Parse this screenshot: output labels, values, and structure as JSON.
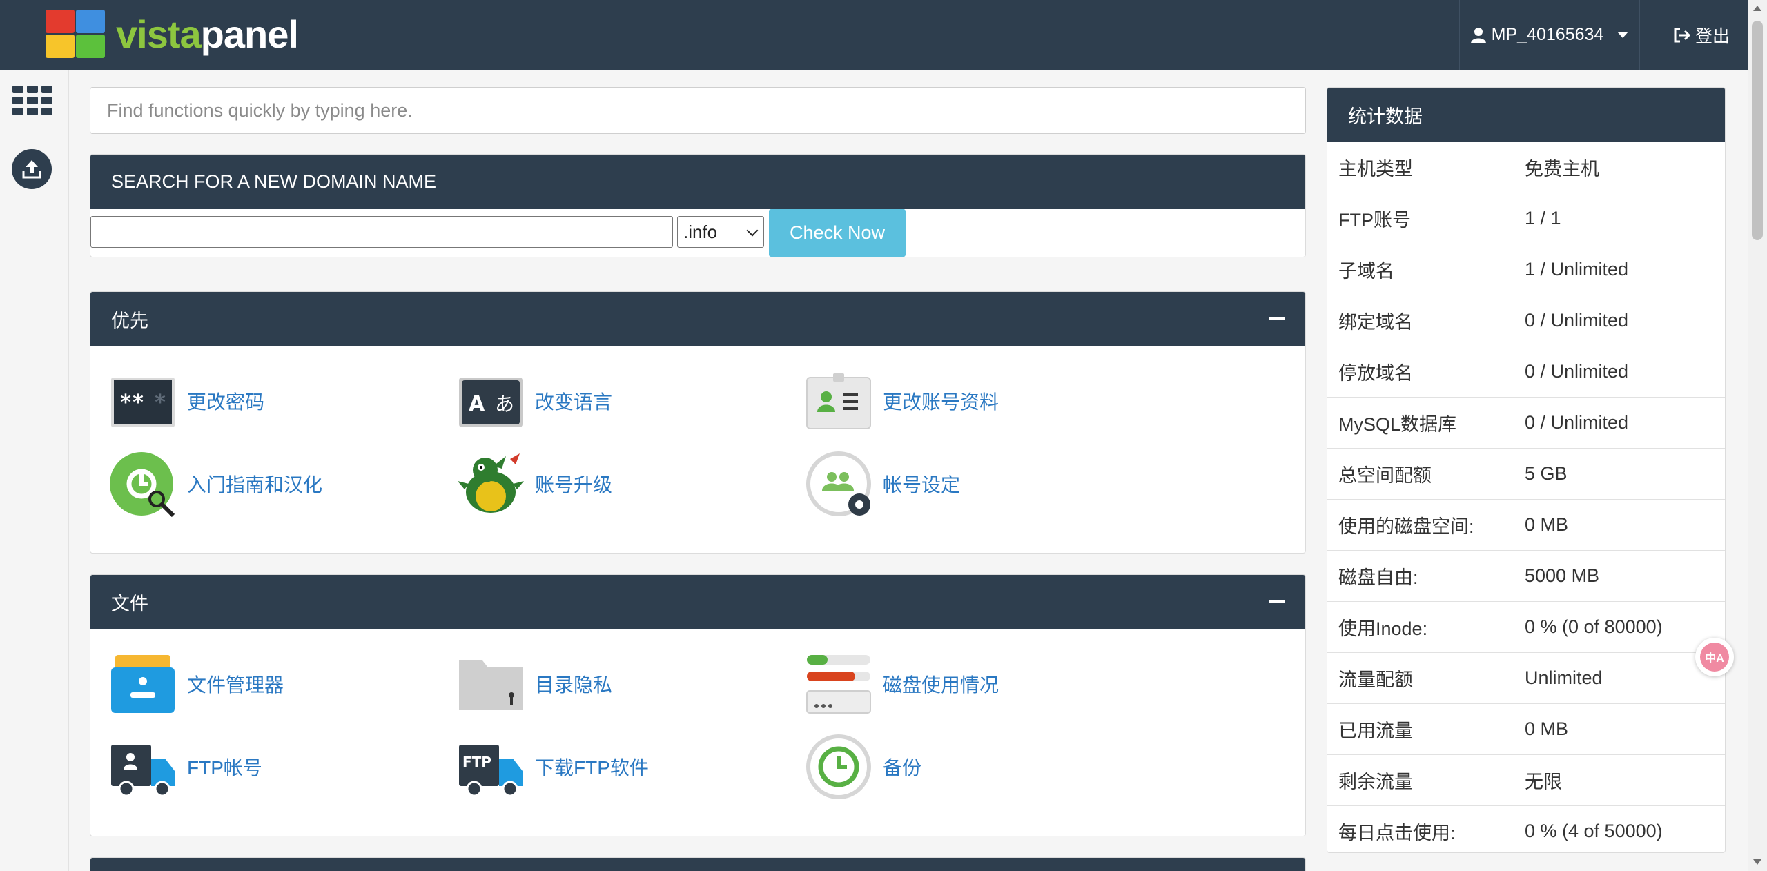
{
  "colors": {
    "navy": "#2e3e4e",
    "link": "#2a78c2",
    "check_btn": "#5bc0de",
    "logo_green": "#8dc63f"
  },
  "header": {
    "logo_part1": "vista",
    "logo_part2": "panel",
    "username": "MP_40165634",
    "logout_label": "登出"
  },
  "sidebar": {
    "icons": [
      "apps-grid-icon",
      "upload-icon"
    ]
  },
  "search": {
    "placeholder": "Find functions quickly by typing here."
  },
  "domain_search": {
    "title": "SEARCH FOR A NEW DOMAIN NAME",
    "input_value": "",
    "tld": ".info",
    "button": "Check Now"
  },
  "sections": {
    "priority": {
      "title": "优先",
      "items": [
        {
          "label": "更改密码",
          "icon": "password-icon"
        },
        {
          "label": "改变语言",
          "icon": "language-icon"
        },
        {
          "label": "更改账号资料",
          "icon": "account-card-icon"
        },
        {
          "label": "入门指南和汉化",
          "icon": "getting-started-icon"
        },
        {
          "label": "账号升级",
          "icon": "dragon-icon"
        },
        {
          "label": "帐号设定",
          "icon": "account-settings-icon"
        }
      ]
    },
    "files": {
      "title": "文件",
      "items": [
        {
          "label": "文件管理器",
          "icon": "file-manager-icon"
        },
        {
          "label": "目录隐私",
          "icon": "folder-lock-icon"
        },
        {
          "label": "磁盘使用情况",
          "icon": "disk-usage-icon"
        },
        {
          "label": "FTP帐号",
          "icon": "ftp-user-truck-icon"
        },
        {
          "label": "下载FTP软件",
          "icon": "ftp-truck-icon"
        },
        {
          "label": "备份",
          "icon": "backup-icon"
        }
      ]
    }
  },
  "stats": {
    "title": "统计数据",
    "rows": [
      {
        "k": "主机类型",
        "v": "免费主机"
      },
      {
        "k": "FTP账号",
        "v": "1 / 1"
      },
      {
        "k": "子域名",
        "v": "1 / Unlimited"
      },
      {
        "k": "绑定域名",
        "v": "0 / Unlimited"
      },
      {
        "k": "停放域名",
        "v": "0 / Unlimited"
      },
      {
        "k": "MySQL数据库",
        "v": "0 / Unlimited"
      },
      {
        "k": "总空间配额",
        "v": "5 GB"
      },
      {
        "k": "使用的磁盘空间:",
        "v": "0 MB"
      },
      {
        "k": "磁盘自由:",
        "v": "5000 MB"
      },
      {
        "k": "使用Inode:",
        "v": "0 % (0 of 80000)"
      },
      {
        "k": "流量配额",
        "v": "Unlimited"
      },
      {
        "k": "已用流量",
        "v": "0 MB"
      },
      {
        "k": "剩余流量",
        "v": "无限"
      },
      {
        "k": "每日点击使用:",
        "v": "0 % (4 of 50000)"
      }
    ]
  },
  "translate_widget": {
    "text": "中A"
  }
}
